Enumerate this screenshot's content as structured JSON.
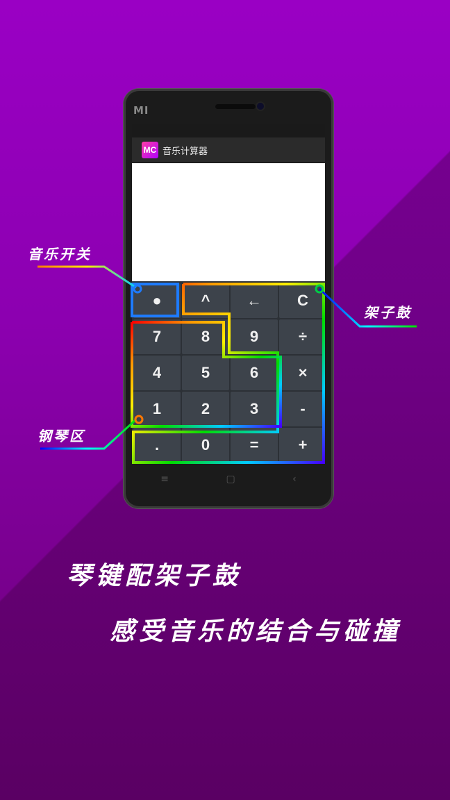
{
  "device": {
    "brand": "MI"
  },
  "app": {
    "icon_text": "MC",
    "title": "音乐计算器"
  },
  "display": {
    "value": ""
  },
  "keypad": {
    "keys": [
      "●",
      "^",
      "←",
      "C",
      "7",
      "8",
      "9",
      "÷",
      "4",
      "5",
      "6",
      "×",
      "1",
      "2",
      "3",
      "-",
      ".",
      "0",
      "=",
      "+"
    ]
  },
  "nav": {
    "menu": "≡",
    "home": "▢",
    "back": "‹"
  },
  "callouts": {
    "music_switch": "音乐开关",
    "drum_kit": "架子鼓",
    "piano_zone": "钢琴区"
  },
  "tagline": {
    "line1": "琴键配架子鼓",
    "line2": "感受音乐的结合与碰撞"
  }
}
